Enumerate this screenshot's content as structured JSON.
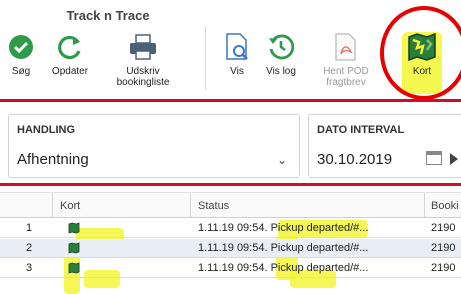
{
  "ribbon": {
    "group_title": "Track n Trace",
    "buttons": [
      {
        "label": "Søg",
        "icon": "check-circle-icon"
      },
      {
        "label": "Opdater",
        "icon": "refresh-icon"
      },
      {
        "label": "Udskriv bookingliste",
        "icon": "printer-icon"
      },
      {
        "label": "Vis",
        "icon": "view-document-icon"
      },
      {
        "label": "Vis log",
        "icon": "history-clock-icon"
      },
      {
        "label": "Hent POD fragtbrev",
        "icon": "pdf-icon"
      },
      {
        "label": "Kort",
        "icon": "map-icon"
      }
    ]
  },
  "filters": {
    "handling_label": "HANDLING",
    "handling_value": "Afhentning",
    "date_label": "DATO INTERVAL",
    "date_value": "30.10.2019"
  },
  "table": {
    "columns": [
      "Kort",
      "Status",
      "Booki"
    ],
    "rows": [
      {
        "num": "1",
        "status": "1.11.19 09:54. Pickup departed/#...",
        "booking": "2190"
      },
      {
        "num": "2",
        "status": "1.11.19 09:54. Pickup departed/#...",
        "booking": "2190"
      },
      {
        "num": "3",
        "status": "1.11.19 09:54. Pickup departed/#...",
        "booking": "2190"
      }
    ]
  },
  "colors": {
    "accent_red": "#c8102e",
    "annotation_yellow": "#f3f63a",
    "annotation_circle": "#e60000",
    "icon_green": "#2e9b4a"
  }
}
